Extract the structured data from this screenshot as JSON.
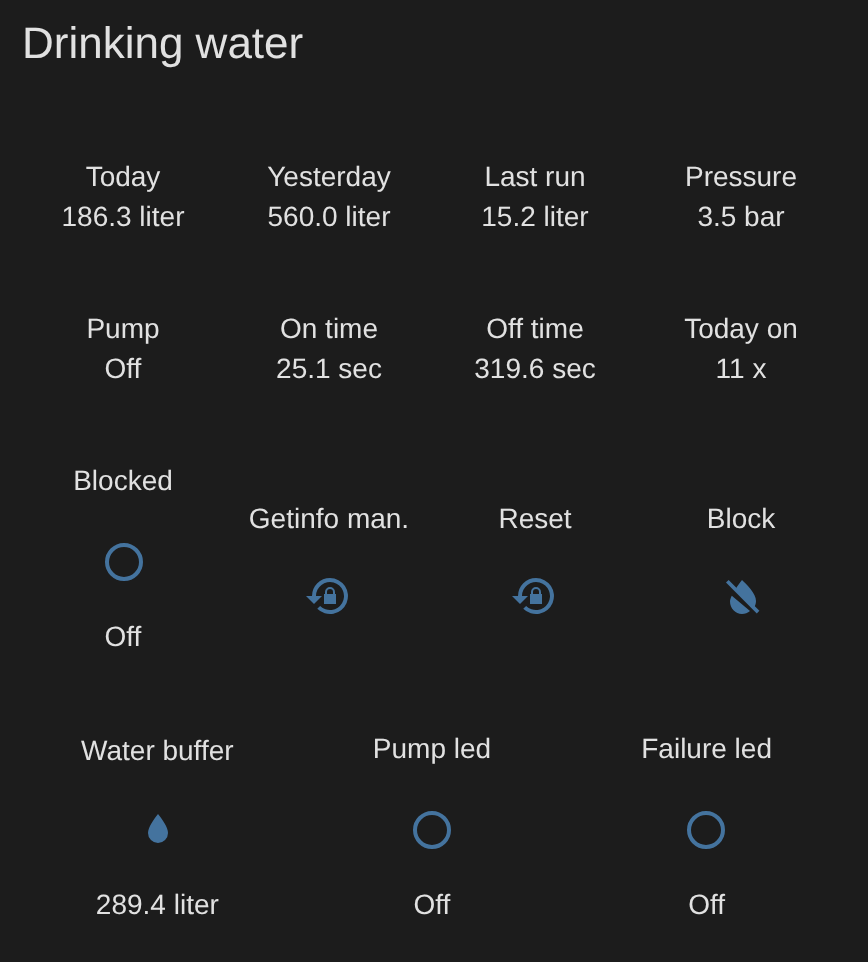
{
  "card": {
    "title": "Drinking water",
    "rows": [
      {
        "entities": [
          {
            "kind": "sensor",
            "label": "Today",
            "value": "186.3 liter"
          },
          {
            "kind": "sensor",
            "label": "Yesterday",
            "value": "560.0 liter"
          },
          {
            "kind": "sensor",
            "label": "Last run",
            "value": "15.2 liter"
          },
          {
            "kind": "sensor",
            "label": "Pressure",
            "value": "3.5 bar"
          }
        ]
      },
      {
        "entities": [
          {
            "kind": "sensor",
            "label": "Pump",
            "value": "Off"
          },
          {
            "kind": "sensor",
            "label": "On time",
            "value": "25.1 sec"
          },
          {
            "kind": "sensor",
            "label": "Off time",
            "value": "319.6 sec"
          },
          {
            "kind": "sensor",
            "label": "Today on",
            "value": "11 x"
          }
        ]
      },
      {
        "entities": [
          {
            "kind": "binary",
            "label": "Blocked",
            "on": false,
            "value": "Off"
          },
          {
            "kind": "reset",
            "label": "Getinfo man."
          },
          {
            "kind": "reset",
            "label": "Reset"
          },
          {
            "kind": "block",
            "label": "Block"
          }
        ]
      },
      {
        "entities": [
          {
            "kind": "drop",
            "label": "Water buffer",
            "value": "289.4 liter"
          },
          {
            "kind": "binary",
            "label": "Pump led",
            "on": false,
            "value": "Off"
          },
          {
            "kind": "binary",
            "label": "Failure led",
            "on": false,
            "value": "Off"
          }
        ]
      }
    ]
  }
}
